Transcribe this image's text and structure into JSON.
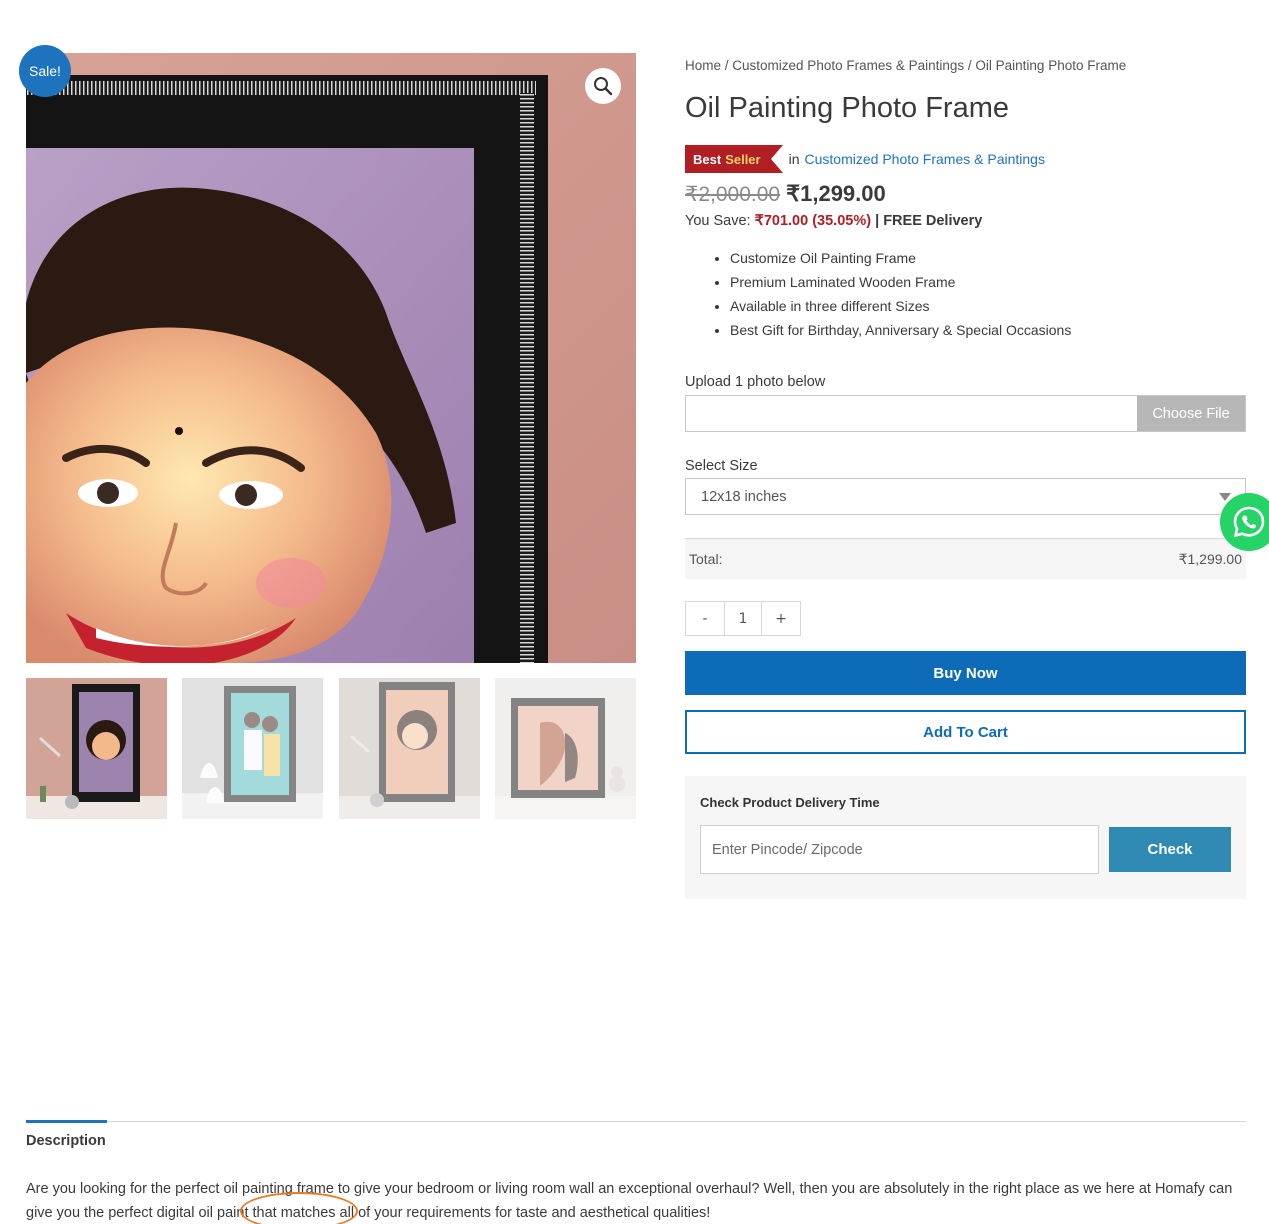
{
  "gallery": {
    "sale_badge": "Sale!",
    "zoom_icon": "magnifier-icon",
    "thumbnails": [
      "thumb-1",
      "thumb-2",
      "thumb-3",
      "thumb-4"
    ]
  },
  "breadcrumb": {
    "home": "Home",
    "sep1": " / ",
    "category": "Customized Photo Frames & Paintings",
    "sep2": " / ",
    "current": "Oil Painting Photo Frame"
  },
  "product": {
    "title": "Oil Painting Photo Frame",
    "badge_best": "Best",
    "badge_seller": "Seller",
    "in_text": "in",
    "category_link": "Customized Photo Frames & Paintings",
    "old_price": "₹2,000.00",
    "new_price": "₹1,299.00",
    "save_label": "You Save: ",
    "save_amount": "₹701.00 (35.05%)",
    "save_sep": " | ",
    "free_delivery": "FREE Delivery",
    "features": [
      "Customize Oil Painting Frame",
      "Premium Laminated Wooden Frame",
      "Available in three different Sizes",
      "Best Gift for Birthday, Anniversary & Special Occasions"
    ]
  },
  "form": {
    "upload_label": "Upload 1 photo below",
    "choose_file": "Choose File",
    "size_label": "Select Size",
    "size_value": "12x18 inches",
    "total_label": "Total:",
    "total_value": "₹1,299.00",
    "qty_minus": "-",
    "qty_value": "1",
    "qty_plus": "+",
    "buy_now": "Buy Now",
    "add_to_cart": "Add To Cart"
  },
  "delivery": {
    "title": "Check Product Delivery Time",
    "placeholder": "Enter Pincode/ Zipcode",
    "check": "Check"
  },
  "tabs": {
    "description_tab": "Description",
    "description_text": "Are you looking for the perfect oil painting frame to give your bedroom or living room wall an exceptional overhaul? Well, then you are absolutely in the right place as we here at Homafy can give you the perfect digital oil paint that matches all of your requirements for taste and aesthetical qualities!"
  },
  "colors": {
    "primary_blue": "#0e6bb8",
    "badge_red": "#b11e23",
    "check_blue": "#2e8ab3",
    "whatsapp_green": "#25d366"
  }
}
